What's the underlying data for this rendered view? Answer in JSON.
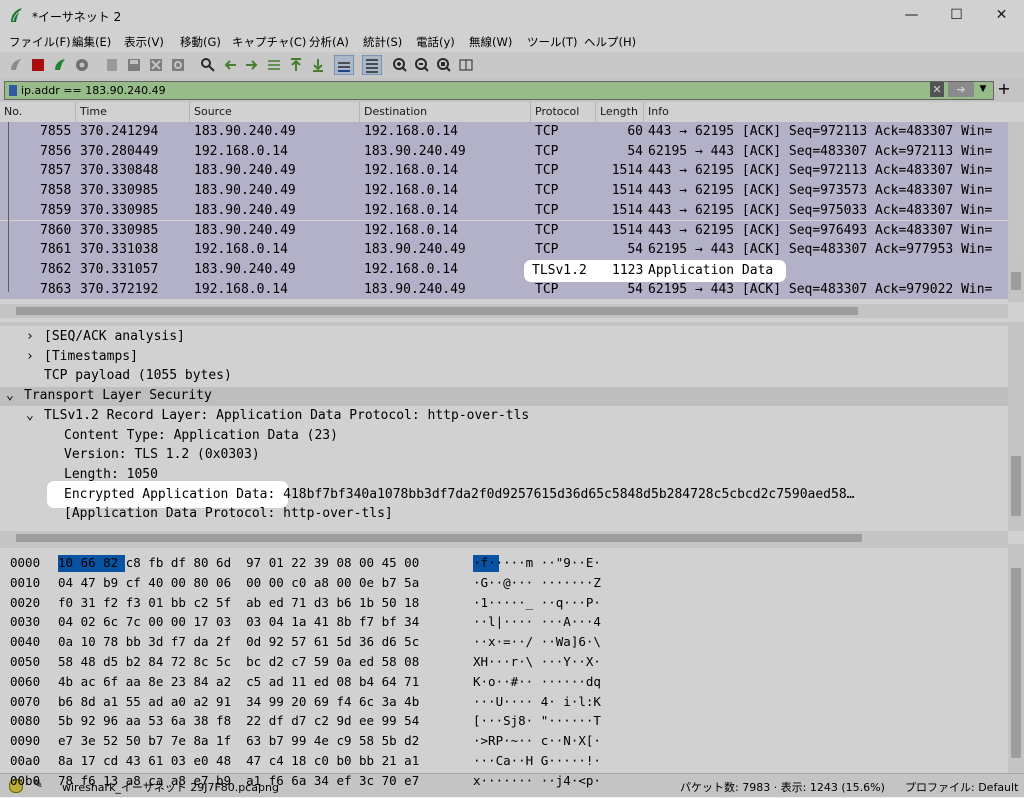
{
  "window": {
    "title": "*イーサネット 2"
  },
  "menu": [
    "ファイル(F)",
    "編集(E)",
    "表示(V)",
    "移動(G)",
    "キャプチャ(C)",
    "分析(A)",
    "統計(S)",
    "電話(y)",
    "無線(W)",
    "ツール(T)",
    "ヘルプ(H)"
  ],
  "filter": {
    "value": "ip.addr == 183.90.240.49"
  },
  "packet_list": {
    "headers": [
      "No.",
      "Time",
      "Source",
      "Destination",
      "Protocol",
      "Length",
      "Info"
    ],
    "rows": [
      {
        "no": "7855",
        "time": "370.241294",
        "src": "183.90.240.49",
        "dst": "192.168.0.14",
        "proto": "TCP",
        "len": "60",
        "info": "443 → 62195 [ACK] Seq=972113 Ack=483307 Win="
      },
      {
        "no": "7856",
        "time": "370.280449",
        "src": "192.168.0.14",
        "dst": "183.90.240.49",
        "proto": "TCP",
        "len": "54",
        "info": "62195 → 443 [ACK] Seq=483307 Ack=972113 Win="
      },
      {
        "no": "7857",
        "time": "370.330848",
        "src": "183.90.240.49",
        "dst": "192.168.0.14",
        "proto": "TCP",
        "len": "1514",
        "info": "443 → 62195 [ACK] Seq=972113 Ack=483307 Win="
      },
      {
        "no": "7858",
        "time": "370.330985",
        "src": "183.90.240.49",
        "dst": "192.168.0.14",
        "proto": "TCP",
        "len": "1514",
        "info": "443 → 62195 [ACK] Seq=973573 Ack=483307 Win="
      },
      {
        "no": "7859",
        "time": "370.330985",
        "src": "183.90.240.49",
        "dst": "192.168.0.14",
        "proto": "TCP",
        "len": "1514",
        "info": "443 → 62195 [ACK] Seq=975033 Ack=483307 Win="
      },
      {
        "no": "7860",
        "time": "370.330985",
        "src": "183.90.240.49",
        "dst": "192.168.0.14",
        "proto": "TCP",
        "len": "1514",
        "info": "443 → 62195 [ACK] Seq=976493 Ack=483307 Win="
      },
      {
        "no": "7861",
        "time": "370.331038",
        "src": "192.168.0.14",
        "dst": "183.90.240.49",
        "proto": "TCP",
        "len": "54",
        "info": "62195 → 443 [ACK] Seq=483307 Ack=977953 Win="
      },
      {
        "no": "7862",
        "time": "370.331057",
        "src": "183.90.240.49",
        "dst": "192.168.0.14",
        "proto": "TLSv1.2",
        "len": "1123",
        "info": "Application Data"
      },
      {
        "no": "7863",
        "time": "370.372192",
        "src": "192.168.0.14",
        "dst": "183.90.240.49",
        "proto": "TCP",
        "len": "54",
        "info": "62195 → 443 [ACK] Seq=483307 Ack=979022 Win="
      }
    ]
  },
  "details": {
    "lines": [
      {
        "indent": 2,
        "arrow": "›",
        "text": "[SEQ/ACK analysis]"
      },
      {
        "indent": 2,
        "arrow": "›",
        "text": "[Timestamps]"
      },
      {
        "indent": 2,
        "arrow": "",
        "text": "TCP payload (1055 bytes)"
      },
      {
        "indent": 1,
        "arrow": "⌄",
        "text": "Transport Layer Security"
      },
      {
        "indent": 2,
        "arrow": "⌄",
        "text": "TLSv1.2 Record Layer: Application Data Protocol: http-over-tls"
      },
      {
        "indent": 3,
        "arrow": "",
        "text": "Content Type: Application Data (23)"
      },
      {
        "indent": 3,
        "arrow": "",
        "text": "Version: TLS 1.2 (0x0303)"
      },
      {
        "indent": 3,
        "arrow": "",
        "text": "Length: 1050"
      },
      {
        "indent": 3,
        "arrow": "",
        "text": "Encrypted Application Data: 418bf7bf340a1078bb3df7da2f0d9257615d36d65c5848d5b284728c5cbcd2c7590aed58…"
      },
      {
        "indent": 3,
        "arrow": "",
        "text": "[Application Data Protocol: http-over-tls]"
      }
    ]
  },
  "bytes": {
    "rows": [
      {
        "off": "0000",
        "hex": "10 66 82 c8 fb df 80 6d  97 01 22 39 08 00 45 00",
        "ascii": "·f·····m ··\"9··E·"
      },
      {
        "off": "0010",
        "hex": "04 47 b9 cf 40 00 80 06  00 00 c0 a8 00 0e b7 5a",
        "ascii": "·G··@··· ·······Z"
      },
      {
        "off": "0020",
        "hex": "f0 31 f2 f3 01 bb c2 5f  ab ed 71 d3 b6 1b 50 18",
        "ascii": "·1·····_ ··q···P·"
      },
      {
        "off": "0030",
        "hex": "04 02 6c 7c 00 00 17 03  03 04 1a 41 8b f7 bf 34",
        "ascii": "··l|···· ···A···4"
      },
      {
        "off": "0040",
        "hex": "0a 10 78 bb 3d f7 da 2f  0d 92 57 61 5d 36 d6 5c",
        "ascii": "··x·=··/ ··Wa]6·\\"
      },
      {
        "off": "0050",
        "hex": "58 48 d5 b2 84 72 8c 5c  bc d2 c7 59 0a ed 58 08",
        "ascii": "XH···r·\\ ···Y··X·"
      },
      {
        "off": "0060",
        "hex": "4b ac 6f aa 8e 23 84 a2  c5 ad 11 ed 08 b4 64 71",
        "ascii": "K·o··#·· ······dq"
      },
      {
        "off": "0070",
        "hex": "b6 8d a1 55 ad a0 a2 91  34 99 20 69 f4 6c 3a 4b",
        "ascii": "···U···· 4· i·l:K"
      },
      {
        "off": "0080",
        "hex": "5b 92 96 aa 53 6a 38 f8  22 df d7 c2 9d ee 99 54",
        "ascii": "[···Sj8· \"······T"
      },
      {
        "off": "0090",
        "hex": "e7 3e 52 50 b7 7e 8a 1f  63 b7 99 4e c9 58 5b d2",
        "ascii": "·>RP·~·· c··N·X[·"
      },
      {
        "off": "00a0",
        "hex": "8a 17 cd 43 61 03 e0 48  47 c4 18 c0 b0 bb 21 a1",
        "ascii": "···Ca··H G·····!·"
      },
      {
        "off": "00b0",
        "hex": "78 f6 13 a8 ca a8 e7 b9  a1 f6 6a 34 ef 3c 70 e7",
        "ascii": "x······· ··j4·<p·"
      }
    ]
  },
  "status": {
    "file": "wireshark_イーサネット 29J7F80.pcapng",
    "packets": "パケット数: 7983 · 表示: 1243 (15.6%)",
    "profile": "プロファイル: Default"
  },
  "colors": {
    "row_bg": "#dad8f4",
    "filter_bg": "#b9e5a8",
    "select": "#0a64c8"
  }
}
